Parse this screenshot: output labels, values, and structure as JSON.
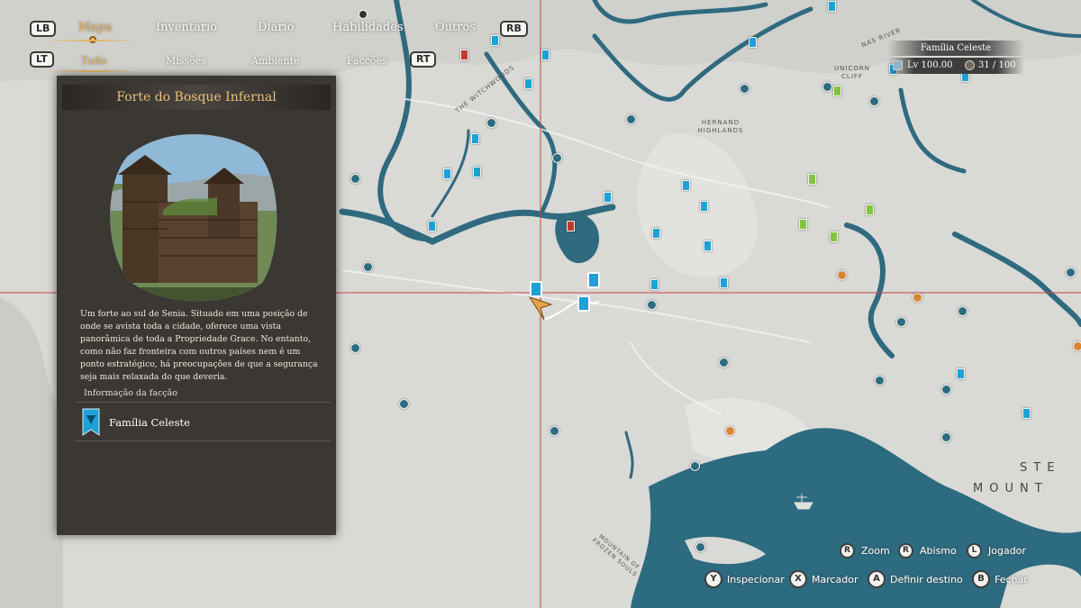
{
  "tabs": {
    "lb": "LB",
    "rb": "RB",
    "lt": "LT",
    "rt": "RT",
    "main": [
      "Mapa",
      "Inventário",
      "Diário",
      "Habilidades",
      "Outros"
    ],
    "sub": [
      "Tudo",
      "Missões",
      "Ambiente",
      "Facções"
    ]
  },
  "panel": {
    "title": "Forte do Bosque Infernal",
    "description": "Um forte ao sul de Senia. Situado em uma posição de onde se avista toda a cidade, oferece uma vista panorâmica de toda a Propriedade Grace. No entanto, como não faz fronteira com outros países nem é um ponto estratégico, há preocupações de que a segurança seja mais relaxada do que deveria.",
    "faction_header": "Informação da facção",
    "faction_name": "Família Celeste"
  },
  "player": {
    "name": "Família Celeste",
    "level": "Lv 100.00",
    "count": "31 / 100"
  },
  "map_labels": {
    "nas_river": "NAS RIVER",
    "unicorn_cliff": "UNICORN CLIFF",
    "the_witchwoods": "THE WITCHWOODS",
    "hernand_highlands": "HERNAND HIGHLANDS",
    "mountain": "MOUNTAIN OF FROZEN SOULS",
    "ste_mount_1": "STE",
    "ste_mount_2": "MOUNT"
  },
  "controls": {
    "zoom_key": "R",
    "zoom": "Zoom",
    "abismo_key": "R",
    "abismo": "Abismo",
    "jogador_key": "L",
    "jogador": "Jogador",
    "inspect_key": "Y",
    "inspect": "Inspecionar",
    "marker_key": "X",
    "marker": "Marcador",
    "dest_key": "A",
    "dest": "Definir destino",
    "close_key": "B",
    "close": "Fechar"
  },
  "colors": {
    "land": "#d9d9d6",
    "water": "#2c6b80",
    "river": "#2f6a7f",
    "accent": "#e6b35a",
    "panel": "#3b3733",
    "crosshair": "#c9463d",
    "faction_blue": "#1ea1d6"
  }
}
